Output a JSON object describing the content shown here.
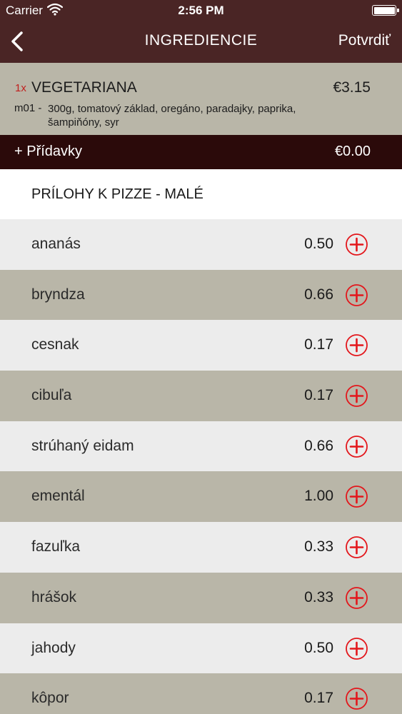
{
  "status_bar": {
    "carrier": "Carrier",
    "time": "2:56 PM"
  },
  "nav": {
    "title": "INGREDIENCIE",
    "confirm_label": "Potvrdiť"
  },
  "order": {
    "qty": "1x",
    "name": "VEGETARIANA",
    "price": "€3.15",
    "code": "m01 -",
    "description": "300g, tomatový základ, oregáno, paradajky, paprika, šampiňóny, syr"
  },
  "extras": {
    "label": "+ Přídavky",
    "price": "€0.00"
  },
  "section": {
    "title": "PRÍLOHY K PIZZE - MALÉ"
  },
  "items": [
    {
      "name": "ananás",
      "price": "0.50"
    },
    {
      "name": "bryndza",
      "price": "0.66"
    },
    {
      "name": "cesnak",
      "price": "0.17"
    },
    {
      "name": "cibuľa",
      "price": "0.17"
    },
    {
      "name": "strúhaný eidam",
      "price": "0.66"
    },
    {
      "name": "ementál",
      "price": "1.00"
    },
    {
      "name": "fazuľka",
      "price": "0.33"
    },
    {
      "name": "hrášok",
      "price": "0.33"
    },
    {
      "name": "jahody",
      "price": "0.50"
    },
    {
      "name": "kôpor",
      "price": "0.17"
    }
  ],
  "colors": {
    "topbar": "#4a2525",
    "order_bg": "#b9b6a8",
    "extras_bg": "#2b0a0a",
    "row_light": "#ececec",
    "row_dark": "#b9b6a8",
    "accent_red": "#e3161b"
  },
  "icons": {
    "back": "chevron-left-icon",
    "wifi": "wifi-icon",
    "battery": "battery-icon",
    "add": "plus-circle-icon"
  }
}
